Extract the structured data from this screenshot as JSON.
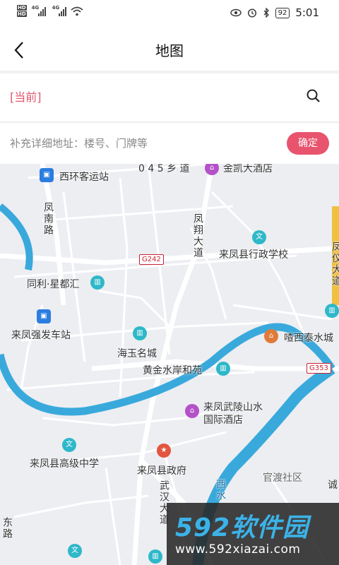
{
  "status_bar": {
    "hd1": "HD",
    "hd2": "HD",
    "net1": "4G",
    "net2": "4G",
    "battery": "92",
    "time": "5:01"
  },
  "header": {
    "title": "地图"
  },
  "search": {
    "current_label": "[当前]"
  },
  "address": {
    "placeholder": "补充详细地址：楼号、门牌等",
    "confirm_label": "确定"
  },
  "map": {
    "labels": {
      "road_045": "0 4 5 乡 道",
      "jinkai_hotel": "金凯大酒店",
      "xihuan_station": "西环客运站",
      "fengnan_road": "凤南路",
      "fengxiang_road": "凤翔大道",
      "admin_school": "来凤县行政学校",
      "g242": "G242",
      "fengyi_road": "凤仪大道",
      "tongli": "同利·星都汇",
      "qiangfa_station": "来凤强发车站",
      "haiyu": "海玉名城",
      "tangxitai": "喳西泰水城",
      "huangjin": "黄金水岸和苑",
      "g353": "G353",
      "wuling_hotel": "来凤武陵山水国际酒店",
      "high_school": "来凤县高级中学",
      "gov": "来凤县政府",
      "wuhan_road": "武汉大道",
      "xishui": "西水",
      "guandu": "官渡社区",
      "cheng": "诚",
      "bottom_road": "东路"
    }
  },
  "watermark": {
    "main": "592软件园",
    "sub": "www.592xiazai.com"
  },
  "colors": {
    "accent": "#e8546e",
    "river": "#39a9dc",
    "poi_teal": "#2eb8c9"
  }
}
